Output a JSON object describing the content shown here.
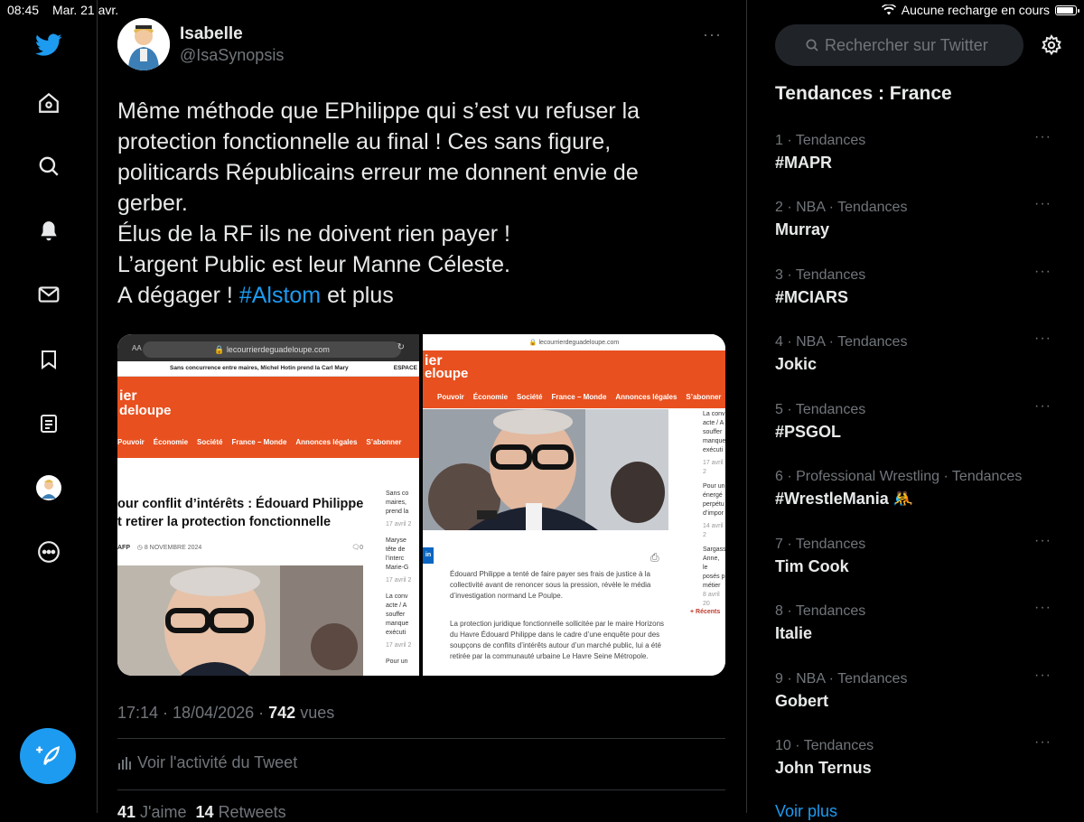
{
  "status_bar": {
    "time": "08:45",
    "date": "Mar. 21 avr.",
    "charging": "Aucune recharge en cours"
  },
  "nav": {
    "items": [
      "twitter-logo",
      "home-icon",
      "search-icon",
      "notifications-icon",
      "messages-icon",
      "bookmarks-icon",
      "lists-icon",
      "profile-avatar",
      "more-icon"
    ],
    "compose_icon": "compose-tweet-icon"
  },
  "tweet": {
    "author_name": "Isabelle",
    "author_handle": "@IsaSynopsis",
    "more": "···",
    "lines": [
      "Même méthode que EPhilippe qui s’est vu refuser la",
      "protection fonctionnelle au final ! Ces sans figure,",
      "politicards Républicains  erreur me donnent envie de",
      "gerber.",
      "Élus de la RF ils ne doivent rien payer !",
      "L’argent Public est leur Manne Céleste."
    ],
    "last_line_prefix": "A dégager ! ",
    "hashtag": "#Alstom",
    "last_line_suffix": " et plus",
    "time": "17:14",
    "date": "18/04/2026",
    "views_count": "742",
    "views_label": "vues",
    "activity_label": "Voir l'activité du Tweet",
    "likes_count": "41",
    "likes_label": "J'aime",
    "retweets_count": "14",
    "retweets_label": "Retweets"
  },
  "media": {
    "left": {
      "aa": "AA",
      "url": "lecourrierdeguadeloupe.com",
      "ticker": "Sans concurrence entre maires, Michel Hotin prend la Carl     Mary",
      "ticker_right": "ESPACE",
      "brand_line1": "ier",
      "brand_line2": "deloupe",
      "menu": [
        "Pouvoir",
        "Économie",
        "Société",
        "France – Monde",
        "Annonces légales",
        "S’abonner"
      ],
      "headline_line1": "our conflit d’intérêts : Édouard Philippe",
      "headline_line2": "t retirer la protection fonctionnelle",
      "byline": "AFP",
      "date": "8 NOVEMBRE 2024",
      "comments": "0",
      "side": [
        "Sans co",
        "maires,",
        "prend la",
        "17 avril 2",
        "Maryse",
        "tête de",
        "l’interc",
        "Marie-G",
        "17 avril 2",
        "La conv",
        "acte / A",
        "souffer",
        "manque",
        "exécuti",
        "17 avril 2",
        "Pour un"
      ]
    },
    "right": {
      "url": "lecourrierdeguadeloupe.com",
      "brand_line1": "ier",
      "brand_line2": "eloupe",
      "menu": [
        "Pouvoir",
        "Économie",
        "Société",
        "France – Monde",
        "Annonces légales",
        "S’abonner"
      ],
      "article_p1": "Édouard Philippe a tenté de faire payer ses frais de justice à la collectivité avant de renoncer sous la pression, révèle le média d’investigation normand Le Poulpe.",
      "article_p2": "La protection juridique fonctionnelle sollicitée par le maire Horizons du Havre Édouard Philippe dans le cadre d’une enquête pour des soupçons de conflits d’intérêts autour d’un marché public, lui a été retirée par la communauté urbaine Le Havre Seine Métropole.",
      "side": [
        "La conv",
        "acte / A",
        "souffer",
        "manque",
        "exécuti",
        "17 avril 2",
        "Pour un",
        "énergé",
        "perpétu",
        "d’impor",
        "14 avril 2",
        "Sargass",
        "Anne, le",
        "posés p",
        "métier",
        "8 avril 20"
      ],
      "recents": "+ Récents",
      "in_badge": "in"
    }
  },
  "sidebar": {
    "search_placeholder": "Rechercher sur Twitter",
    "trends_title": "Tendances : France",
    "trends": [
      {
        "context": "1 · Tendances",
        "name": "#MAPR"
      },
      {
        "context": "2 · NBA · Tendances",
        "name": "Murray"
      },
      {
        "context": "3 · Tendances",
        "name": "#MCIARS"
      },
      {
        "context": "4 · NBA · Tendances",
        "name": "Jokic"
      },
      {
        "context": "5 · Tendances",
        "name": "#PSGOL"
      },
      {
        "context": "6 · Professional Wrestling · Tendances",
        "name": "#WrestleMania 🤼"
      },
      {
        "context": "7 · Tendances",
        "name": "Tim Cook"
      },
      {
        "context": "8 · Tendances",
        "name": "Italie"
      },
      {
        "context": "9 · NBA · Tendances",
        "name": "Gobert"
      },
      {
        "context": "10 · Tendances",
        "name": "John Ternus"
      }
    ],
    "more_dots": "···",
    "show_more": "Voir plus"
  },
  "colors": {
    "accent": "#1d9bf0",
    "background": "#000000",
    "secondary_text": "#71767b",
    "brand_orange": "#e8501f"
  }
}
